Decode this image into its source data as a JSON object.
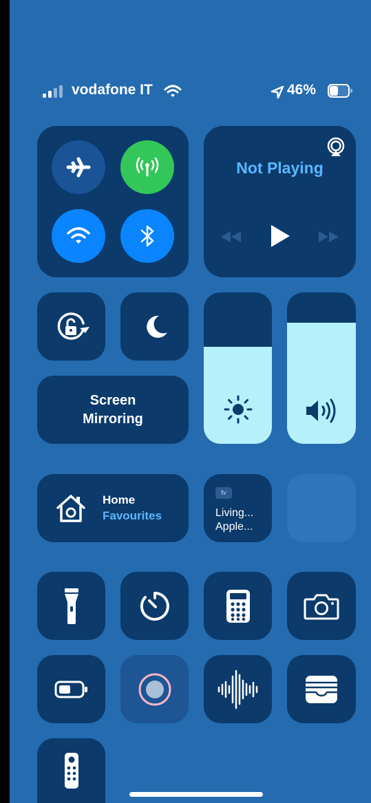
{
  "status_bar": {
    "carrier": "vodafone IT",
    "battery_percent": "46%",
    "battery_level": 0.46
  },
  "media": {
    "title": "Not Playing"
  },
  "screen_mirroring": {
    "line1": "Screen",
    "line2": "Mirroring"
  },
  "sliders": {
    "brightness_level": 0.64,
    "volume_level": 0.8
  },
  "home": {
    "title": "Home",
    "subtitle": "Favourites"
  },
  "appletv": {
    "badge": "tv",
    "line1": "Living...",
    "line2": "Apple..."
  },
  "colors": {
    "background": "#246bb0",
    "tile": "#0b3a6b",
    "active_blue": "#0a84ff",
    "cellular_green": "#33c759",
    "slider_fill": "#b5f0fb",
    "subtitle_blue": "#5ab6ff"
  },
  "icons": [
    "airplane-icon",
    "cellular-icon",
    "wifi-icon",
    "bluetooth-icon",
    "airplay-icon",
    "rewind-icon",
    "play-icon",
    "fast-forward-icon",
    "rotation-lock-icon",
    "moon-icon",
    "brightness-icon",
    "volume-icon",
    "home-icon",
    "flashlight-icon",
    "timer-icon",
    "calculator-icon",
    "camera-icon",
    "low-power-icon",
    "screen-record-icon",
    "voice-memo-icon",
    "wallet-icon",
    "remote-icon"
  ]
}
